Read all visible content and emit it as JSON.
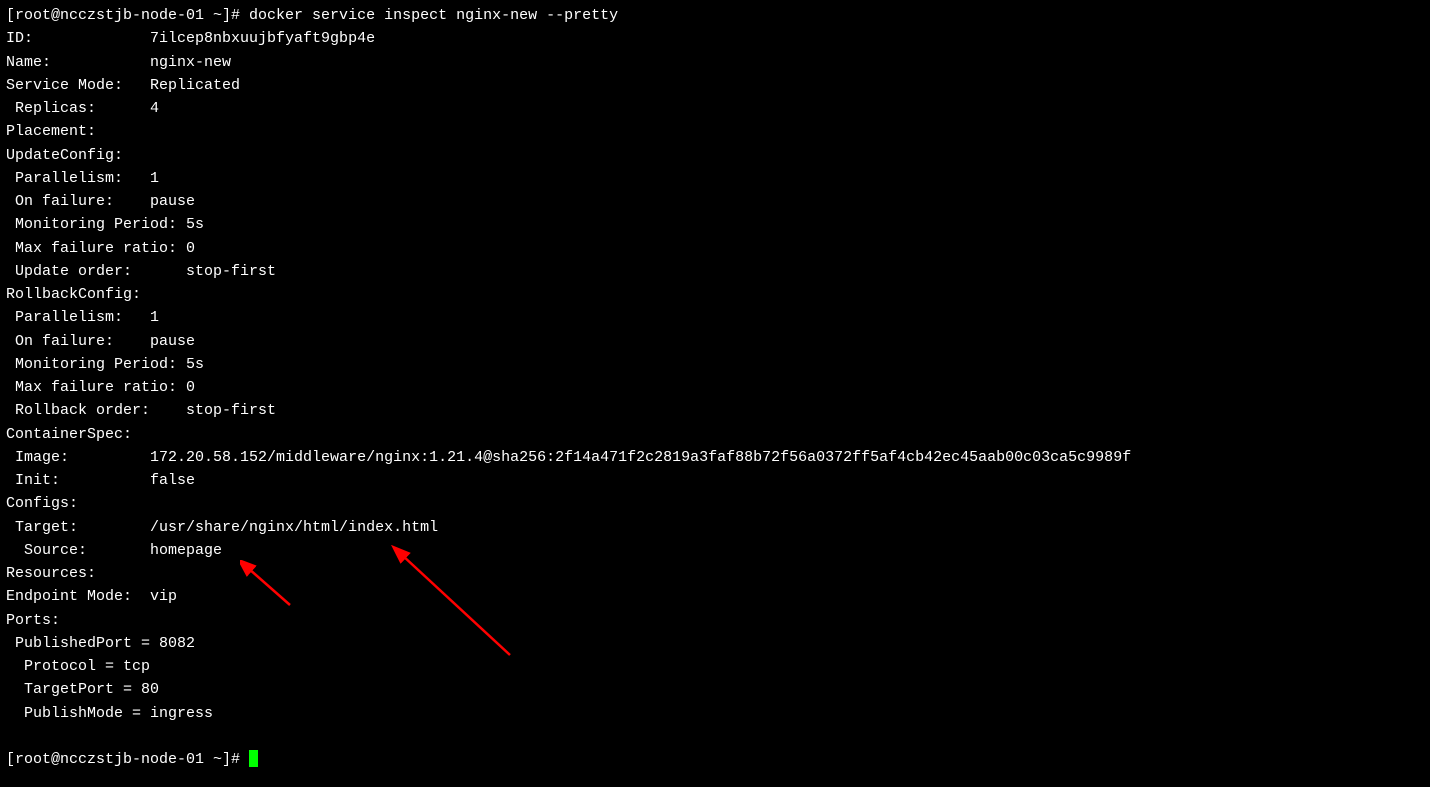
{
  "prompt1": "[root@ncczstjb-node-01 ~]# ",
  "command": "docker service inspect nginx-new --pretty",
  "spacer": "",
  "fields": {
    "id_label": "ID:             ",
    "id_value": "7ilcep8nbxuujbfyaft9gbp4e",
    "name_label": "Name:           ",
    "name_value": "nginx-new",
    "mode_label": "Service Mode:   ",
    "mode_value": "Replicated",
    "replicas_label": " Replicas:      ",
    "replicas_value": "4",
    "placement": "Placement:",
    "update_config": "UpdateConfig:",
    "u_parallelism_label": " Parallelism:   ",
    "u_parallelism_value": "1",
    "u_onfailure_label": " On failure:    ",
    "u_onfailure_value": "pause",
    "u_monitoring_label": " Monitoring Period: ",
    "u_monitoring_value": "5s",
    "u_maxfail_label": " Max failure ratio: ",
    "u_maxfail_value": "0",
    "u_order_label": " Update order:      ",
    "u_order_value": "stop-first",
    "rollback_config": "RollbackConfig:",
    "r_parallelism_label": " Parallelism:   ",
    "r_parallelism_value": "1",
    "r_onfailure_label": " On failure:    ",
    "r_onfailure_value": "pause",
    "r_monitoring_label": " Monitoring Period: ",
    "r_monitoring_value": "5s",
    "r_maxfail_label": " Max failure ratio: ",
    "r_maxfail_value": "0",
    "r_order_label": " Rollback order:    ",
    "r_order_value": "stop-first",
    "container_spec": "ContainerSpec:",
    "image_label": " Image:         ",
    "image_value": "172.20.58.152/middleware/nginx:1.21.4@sha256:2f14a471f2c2819a3faf88b72f56a0372ff5af4cb42ec45aab00c03ca5c9989f",
    "init_label": " Init:          ",
    "init_value": "false",
    "configs": "Configs:",
    "target_label": " Target:        ",
    "target_value": "/usr/share/nginx/html/index.html",
    "source_label": "  Source:       ",
    "source_value": "homepage",
    "resources": "Resources:",
    "endpoint_label": "Endpoint Mode:  ",
    "endpoint_value": "vip",
    "ports": "Ports:",
    "published_port": " PublishedPort = 8082",
    "protocol": "  Protocol = tcp",
    "target_port": "  TargetPort = 80",
    "publish_mode": "  PublishMode = ingress",
    "prompt2": "[root@ncczstjb-node-01 ~]# "
  }
}
